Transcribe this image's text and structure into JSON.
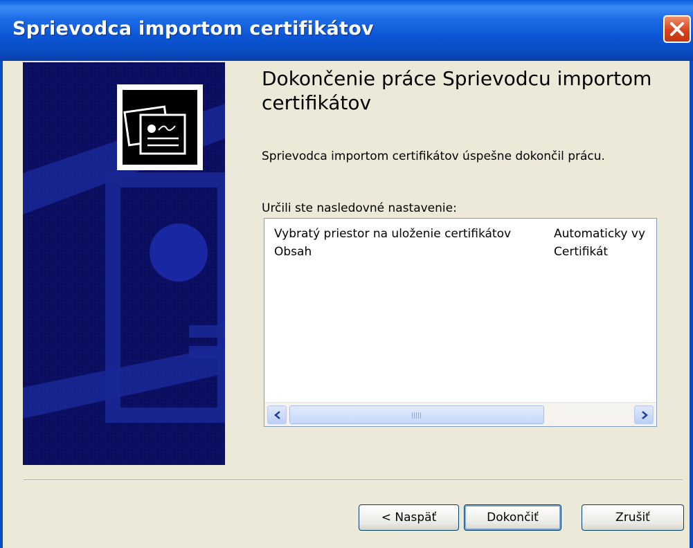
{
  "window": {
    "title": "Sprievodca importom certifikátov"
  },
  "content": {
    "heading": "Dokončenie práce Sprievodcu importom certifikátov",
    "message": "Sprievodca importom certifikátov úspešne dokončil prácu.",
    "settings_label": "Určili ste nasledovné nastavenie:"
  },
  "settings": {
    "rows": [
      {
        "name": "Vybratý priestor na uloženie certifikátov",
        "value": "Automaticky vy"
      },
      {
        "name": "Obsah",
        "value": "Certifikát"
      }
    ]
  },
  "buttons": {
    "back": "< Naspäť",
    "finish": "Dokončiť",
    "cancel": "Zrušiť"
  },
  "colors": {
    "titlebar": "#0a4cc2",
    "banner": "#0a0f5e",
    "window_bg": "#ece9d8"
  },
  "icons": {
    "close": "close-icon",
    "banner": "certificate-icon",
    "scroll_left": "arrow-left-icon",
    "scroll_right": "arrow-right-icon"
  }
}
